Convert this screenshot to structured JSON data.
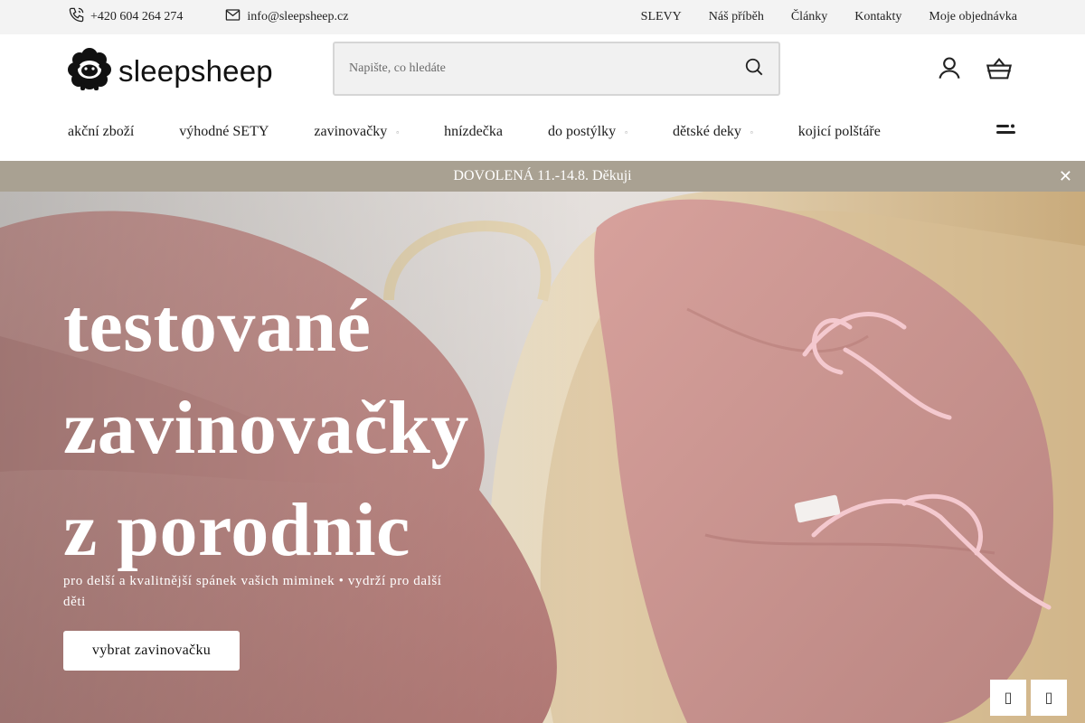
{
  "topbar": {
    "phone": "+420 604 264 274",
    "email": "info@sleepsheep.cz",
    "links": [
      "SLEVY",
      "Náš příběh",
      "Články",
      "Kontakty",
      "Moje objednávka"
    ]
  },
  "header": {
    "logo_text": "sleepsheep",
    "search_placeholder": "Napište, co hledáte"
  },
  "nav": {
    "items": [
      {
        "label": "akční zboží",
        "has_dropdown": false
      },
      {
        "label": "výhodné SETY",
        "has_dropdown": false
      },
      {
        "label": "zavinovačky",
        "has_dropdown": true
      },
      {
        "label": "hnízdečka",
        "has_dropdown": false
      },
      {
        "label": "do postýlky",
        "has_dropdown": true
      },
      {
        "label": "dětské deky",
        "has_dropdown": true
      },
      {
        "label": "kojicí polštáře",
        "has_dropdown": false
      }
    ],
    "dropdown_glyph": "▫"
  },
  "notice": {
    "text": "DOVOLENÁ 11.-14.8. Děkuji",
    "close_glyph": "✕",
    "background": "#a9a192"
  },
  "hero": {
    "title_lines": [
      "testované",
      "zavinovačky",
      "z porodnic"
    ],
    "subtitle": "pro delší a kvalitnější spánek vašich miminek • vydrží pro další děti",
    "button_label": "vybrat zavinovačku",
    "prev_glyph": "▯",
    "next_glyph": "▯"
  },
  "colors": {
    "accent": "#a9a192",
    "blanket": "#c98f8b",
    "basket": "#d9c29a"
  },
  "icons": {
    "phone": "phone-icon",
    "email": "mail-icon",
    "search": "search-icon",
    "user": "user-icon",
    "cart": "basket-icon",
    "menu": "menu-icon",
    "close": "close-icon"
  }
}
